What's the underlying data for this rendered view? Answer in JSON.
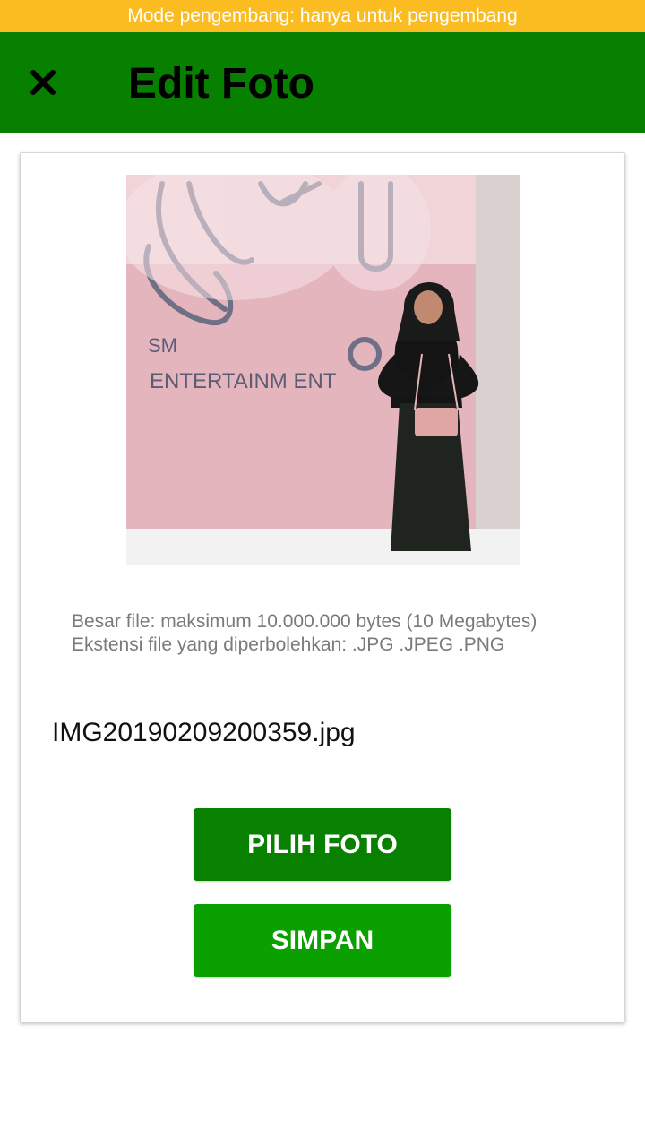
{
  "status_banner": {
    "text": "Mode pengembang: hanya untuk pengembang"
  },
  "appbar": {
    "title": "Edit Foto",
    "close_icon": "close-icon"
  },
  "photo": {
    "alt": "Foto profil",
    "sign_line1": "SM",
    "sign_line2": "ENTERTAINM ENT"
  },
  "info": {
    "max_size": "Besar file: maksimum 10.000.000 bytes (10 Megabytes)",
    "extensions": "Ekstensi file yang diperbolehkan: .JPG .JPEG .PNG"
  },
  "file": {
    "name": "IMG20190209200359.jpg"
  },
  "buttons": {
    "choose": "PILIH FOTO",
    "save": "SIMPAN"
  },
  "colors": {
    "banner": "#FBBC22",
    "appbar": "#078000",
    "choose_button": "#088000",
    "save_button": "#0AA000"
  }
}
